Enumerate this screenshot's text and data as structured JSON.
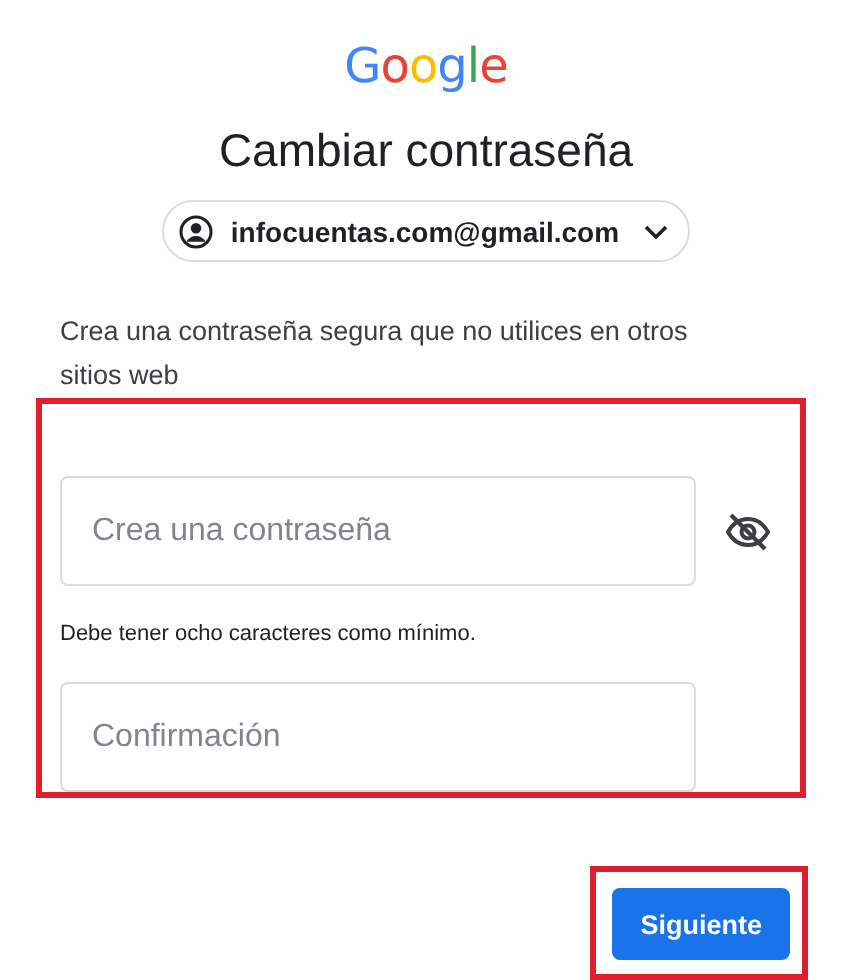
{
  "logo": "Google",
  "title": "Cambiar contraseña",
  "account": {
    "email": "infocuentas.com@gmail.com"
  },
  "description": "Crea una contraseña segura que no utilices en otros sitios web",
  "password_field": {
    "placeholder": "Crea una contraseña",
    "password_visible": false
  },
  "hint": "Debe tener ocho caracteres como mínimo.",
  "confirm_field": {
    "placeholder": "Confirmación"
  },
  "buttons": [
    "Siguiente"
  ]
}
